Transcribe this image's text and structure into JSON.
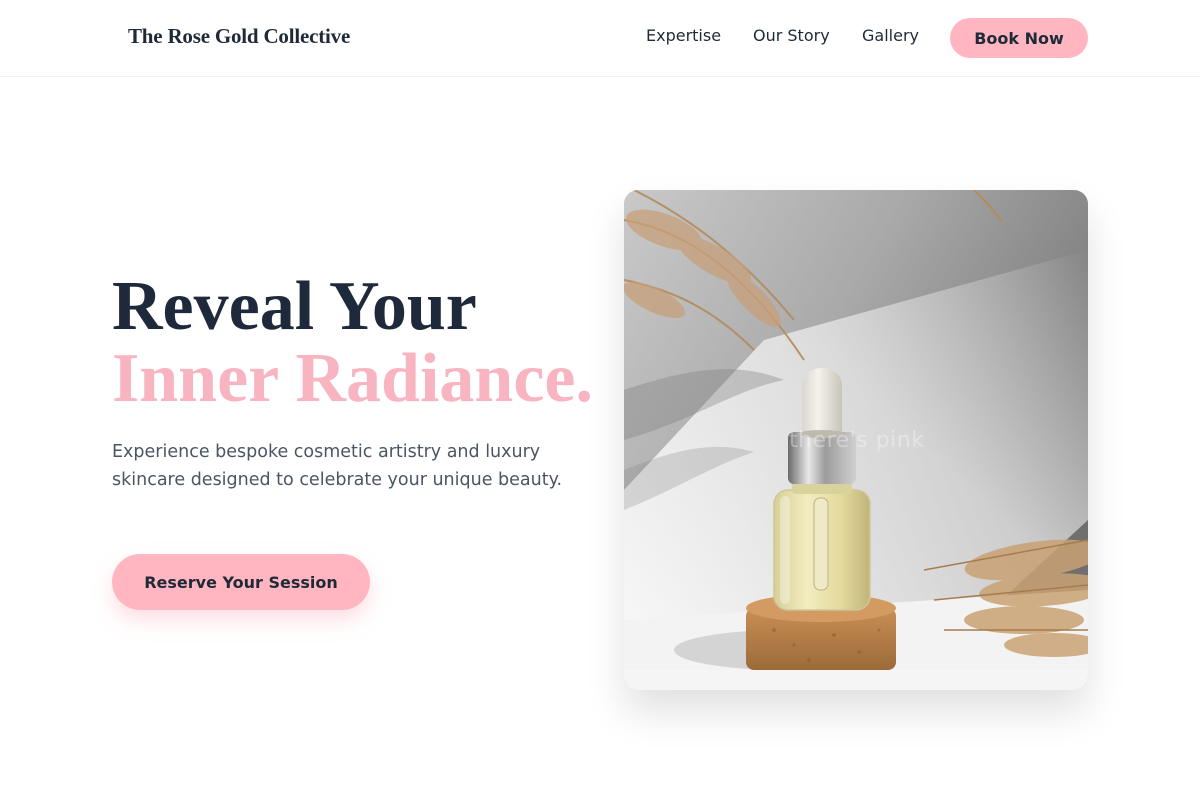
{
  "header": {
    "logo": "The Rose Gold Collective",
    "nav": [
      "Expertise",
      "Our Story",
      "Gallery"
    ],
    "book_label": "Book Now"
  },
  "hero": {
    "title_line1": "Reveal Your",
    "title_line2": "Inner Radiance.",
    "subtitle": "Experience bespoke cosmetic artistry and luxury skincare designed to celebrate your unique beauty.",
    "cta_label": "Reserve Your Session"
  },
  "photo": {
    "subject": "serum dropper bottle on cork stand with dried pampas grass",
    "watermark": "there's pink"
  },
  "colors": {
    "accent": "#ffb6c1",
    "accent_text": "#f8b4c0",
    "heading": "#1e293b",
    "body_text": "#4b5563"
  }
}
